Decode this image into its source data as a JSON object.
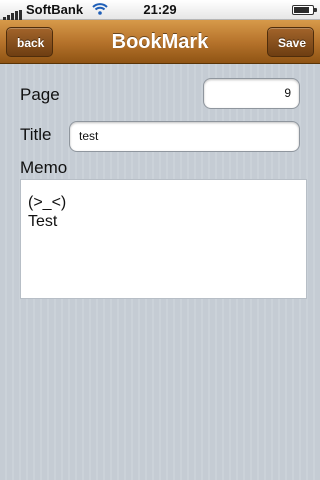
{
  "status_bar": {
    "carrier": "SoftBank",
    "time": "21:29",
    "icons": [
      "signal-icon",
      "wifi-icon",
      "battery-icon"
    ]
  },
  "navbar": {
    "title": "BookMark",
    "back_label": "back",
    "save_label": "Save"
  },
  "form": {
    "page_label": "Page",
    "page_value": "9",
    "title_label": "Title",
    "title_value": "test",
    "memo_label": "Memo",
    "memo_value": "(>_<)\nTest"
  },
  "colors": {
    "navbar": "#b7742c",
    "background": "#c5ccd4"
  }
}
